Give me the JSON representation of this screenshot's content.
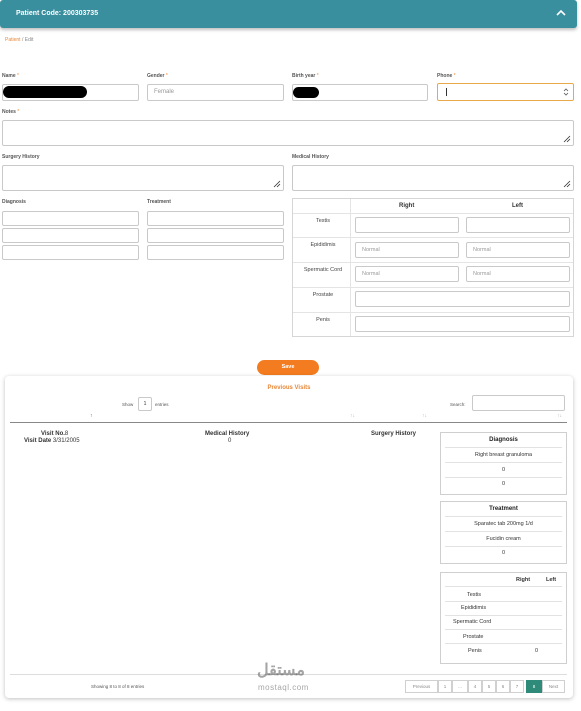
{
  "header": {
    "title": "Patient Code: 200303735",
    "collapse_icon": "chevron-up-icon"
  },
  "breadcrumb": {
    "link": "Patient",
    "separator": "/",
    "current": "Edit"
  },
  "form": {
    "name": {
      "label": "Name",
      "required": "*"
    },
    "gender": {
      "label": "Gender",
      "required": "*",
      "value": "Female"
    },
    "birth_year": {
      "label": "Birth year",
      "required": "*"
    },
    "phone": {
      "label": "Phone",
      "required": "*",
      "value": ""
    },
    "notes": {
      "label": "Notes",
      "required": "*"
    },
    "surgery_history": {
      "label": "Surgery History"
    },
    "medical_history": {
      "label": "Medical History"
    },
    "diagnosis": {
      "label": "Diagnosis"
    },
    "treatment": {
      "label": "Treatment"
    }
  },
  "exam": {
    "col_right": "Right",
    "col_left": "Left",
    "rows": [
      {
        "label": "Testis",
        "right": "",
        "left": ""
      },
      {
        "label": "Epididimis",
        "right_placeholder": "Normal",
        "left_placeholder": "Normal"
      },
      {
        "label": "Spermatic Cord",
        "right_placeholder": "Normal",
        "left_placeholder": "Normal"
      },
      {
        "label": "Prostate"
      },
      {
        "label": "Penis"
      }
    ]
  },
  "save_label": "Save",
  "visits": {
    "title": "Previous Visits",
    "show_label": "Show",
    "show_value": "1",
    "entries_label": "entries",
    "search_label": "Search:",
    "visit_no_label": "Visit No.",
    "visit_no_value": "8",
    "visit_date_label": "Visit Date",
    "visit_date_value": "3/31/2005",
    "medical_history_label": "Medical History",
    "medical_history_value": "0",
    "surgery_history_label": "Surgery History",
    "diagnosis_box": {
      "title": "Diagnosis",
      "items": [
        "Right breast granuloma",
        "0",
        "0"
      ]
    },
    "treatment_box": {
      "title": "Treatment",
      "items": [
        "Sparatec tab 200mg 1/d",
        "Fucidin cream",
        "0"
      ]
    },
    "exam_box": {
      "col_right": "Right",
      "col_left": "Left",
      "rows": [
        {
          "label": "Testis",
          "right": "",
          "left": ""
        },
        {
          "label": "Epididimis",
          "right": "",
          "left": ""
        },
        {
          "label": "Spermatic Cord",
          "right": "",
          "left": ""
        },
        {
          "label": "Prostate",
          "right": "",
          "left": ""
        },
        {
          "label": "Penis",
          "right": "0",
          "left": ""
        }
      ]
    },
    "showing_text": "Showing 8 to 8 of 8 entries",
    "pager": [
      "Previous",
      "1",
      "...",
      "4",
      "5",
      "6",
      "7",
      "8",
      "Next"
    ],
    "pager_active": "8"
  },
  "watermark": {
    "arabic": "مستقل",
    "latin": "mostaql.com"
  },
  "colors": {
    "header": "#3a8f9e",
    "accent": "#f47c20",
    "link": "#e8893a",
    "pager_active": "#2e8b7a"
  }
}
